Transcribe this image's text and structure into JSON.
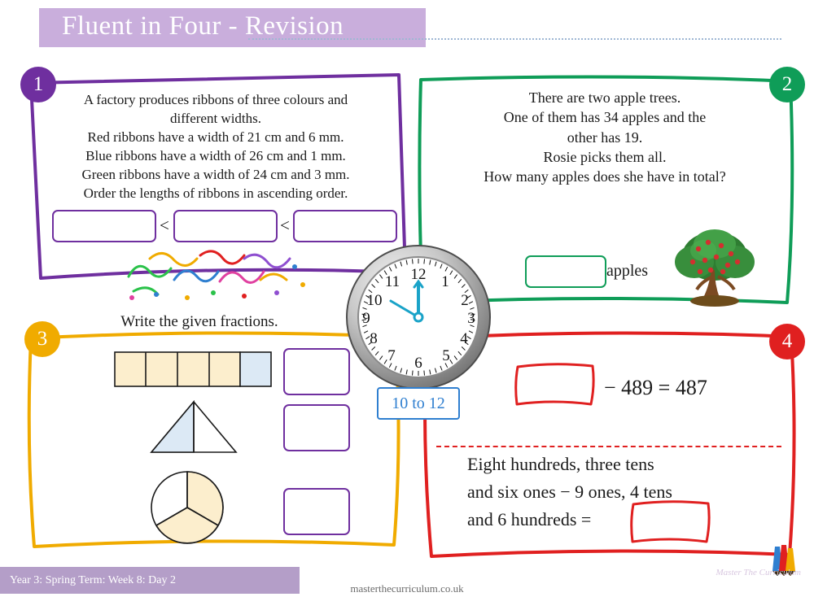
{
  "header": {
    "title": "Fluent in Four - Revision"
  },
  "questions": [
    {
      "number": "1",
      "color": "#6f2f9f",
      "lines": [
        "A factory produces ribbons of three colours and",
        "different widths.",
        "Red ribbons have a width of 21 cm and 6 mm.",
        "Blue ribbons have a width of 26 cm and 1 mm.",
        "Green ribbons have a width of 24 cm and 3 mm.",
        "Order the lengths of ribbons in ascending order."
      ],
      "answer_inputs": [
        "",
        "",
        ""
      ],
      "separators": [
        "<",
        "<"
      ]
    },
    {
      "number": "2",
      "color": "#0f9d58",
      "lines": [
        "There are two apple trees.",
        "One of them has 34 apples and the",
        "other has 19.",
        "Rosie picks them all.",
        "How many apples does she have in total?"
      ],
      "answer_inputs": [
        ""
      ],
      "unit_label": "apples"
    },
    {
      "number": "3",
      "color": "#f0ab00",
      "lines": [
        "Write the given fractions."
      ],
      "answer_inputs": [
        "",
        "",
        ""
      ],
      "shapes": [
        "rectangle-fifths",
        "triangle-halves",
        "circle-thirds"
      ]
    },
    {
      "number": "4",
      "color": "#e02020",
      "equation_1": {
        "box": "",
        "text": "− 489 = 487"
      },
      "equation_2": {
        "lines": [
          "Eight hundreds, three tens",
          "and six ones − 9 ones, 4 tens",
          "and 6 hundreds ="
        ],
        "box": ""
      }
    }
  ],
  "clock": {
    "label": "10 to 12",
    "hour_numbers": [
      "12",
      "1",
      "2",
      "3",
      "4",
      "5",
      "6",
      "7",
      "8",
      "9",
      "10",
      "11"
    ],
    "hour_hand_points_to": "12",
    "minute_hand_points_to": "10"
  },
  "footer": {
    "tab_label": "Year 3: Spring Term: Week 8: Day 2",
    "website": "masterthecurriculum.co.uk",
    "brand": "Master The Curriculum"
  }
}
